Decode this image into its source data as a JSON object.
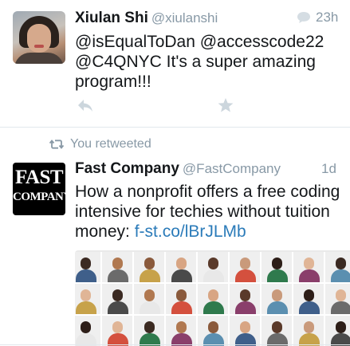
{
  "tweet1": {
    "name": "Xiulan Shi",
    "handle": "@xiulanshi",
    "time": "23h",
    "text_line1": "@isEqualToDan @accesscode22",
    "text_line2": "@C4QNYC It's a super amazing",
    "text_line3": "program!!!",
    "actions": [
      "reply-icon",
      "favorite-icon"
    ]
  },
  "retweet_banner": {
    "text": "You retweeted",
    "icon": "retweet-icon"
  },
  "tweet2": {
    "name": "Fast Company",
    "handle": "@FastCompany",
    "time": "1d",
    "avatar_line1": "FAST",
    "avatar_line2": "COMPANY",
    "text_line1": "How a nonprofit offers a free coding",
    "text_line2": "intensive for techies without tuition",
    "text_prefix": "money: ",
    "link": "f-st.co/lBrJLMb",
    "media": "grid of portrait photos"
  },
  "colors": {
    "text": "#14171a",
    "secondary": "#8899a6",
    "link": "#2b7bb9",
    "divider": "#e1e8ed"
  }
}
